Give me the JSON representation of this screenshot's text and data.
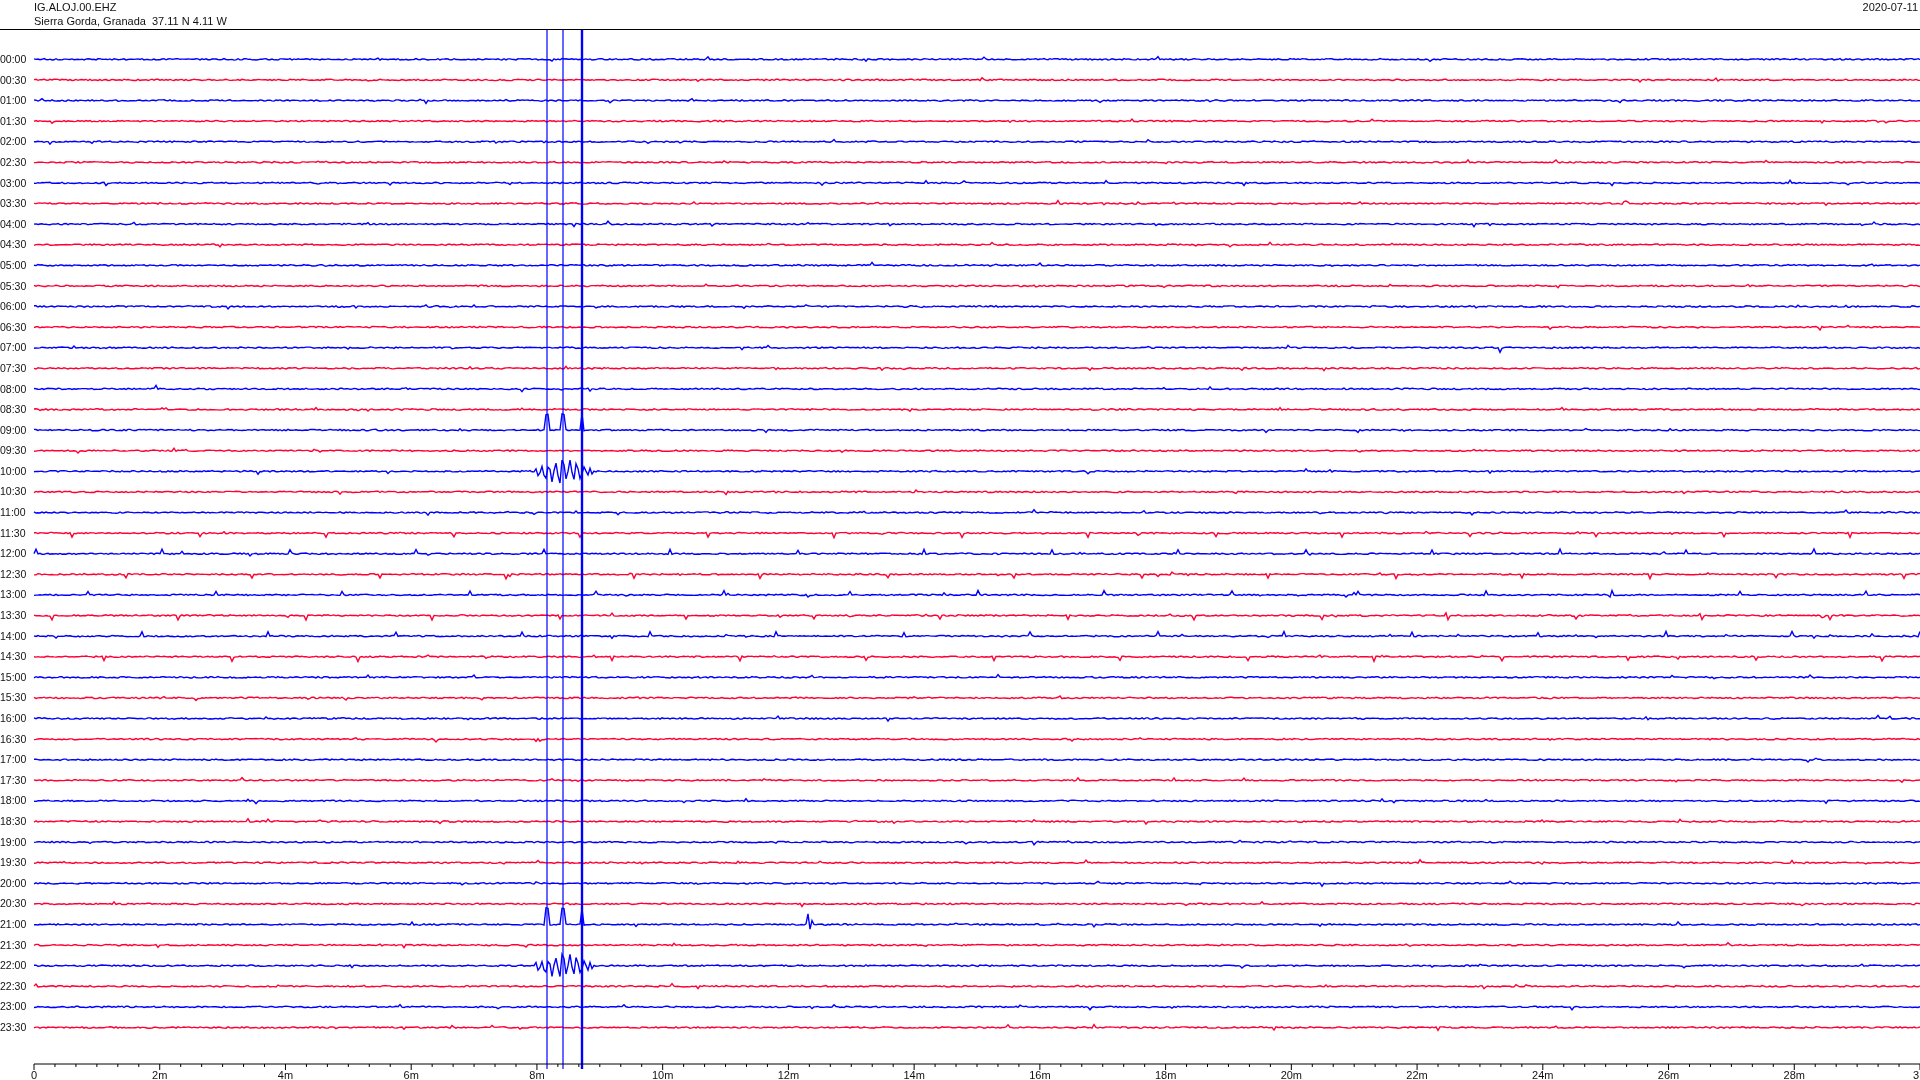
{
  "header": {
    "station": "IG.ALOJ.00.EHZ",
    "location": "Sierra Gorda, Granada  37.11 N 4.11 W",
    "date": "2020-07-11"
  },
  "rows": [
    {
      "label": "00:00",
      "color": "#0000ff"
    },
    {
      "label": "00:30",
      "color": "#ff0033"
    },
    {
      "label": "01:00",
      "color": "#0000ff"
    },
    {
      "label": "01:30",
      "color": "#ff0033"
    },
    {
      "label": "02:00",
      "color": "#0000ff"
    },
    {
      "label": "02:30",
      "color": "#ff0033"
    },
    {
      "label": "03:00",
      "color": "#0000ff"
    },
    {
      "label": "03:30",
      "color": "#ff0033"
    },
    {
      "label": "04:00",
      "color": "#0000ff"
    },
    {
      "label": "04:30",
      "color": "#ff0033"
    },
    {
      "label": "05:00",
      "color": "#0000ff"
    },
    {
      "label": "05:30",
      "color": "#ff0033"
    },
    {
      "label": "06:00",
      "color": "#0000ff"
    },
    {
      "label": "06:30",
      "color": "#ff0033"
    },
    {
      "label": "07:00",
      "color": "#0000ff"
    },
    {
      "label": "07:30",
      "color": "#ff0033"
    },
    {
      "label": "08:00",
      "color": "#0000ff"
    },
    {
      "label": "08:30",
      "color": "#ff0033"
    },
    {
      "label": "09:00",
      "color": "#0000ff"
    },
    {
      "label": "09:30",
      "color": "#ff0033"
    },
    {
      "label": "10:00",
      "color": "#0000ff"
    },
    {
      "label": "10:30",
      "color": "#ff0033"
    },
    {
      "label": "11:00",
      "color": "#0000ff"
    },
    {
      "label": "11:30",
      "color": "#ff0033"
    },
    {
      "label": "12:00",
      "color": "#0000ff"
    },
    {
      "label": "12:30",
      "color": "#ff0033"
    },
    {
      "label": "13:00",
      "color": "#0000ff"
    },
    {
      "label": "13:30",
      "color": "#ff0033"
    },
    {
      "label": "14:00",
      "color": "#0000ff"
    },
    {
      "label": "14:30",
      "color": "#ff0033"
    },
    {
      "label": "15:00",
      "color": "#0000ff"
    },
    {
      "label": "15:30",
      "color": "#ff0033"
    },
    {
      "label": "16:00",
      "color": "#0000ff"
    },
    {
      "label": "16:30",
      "color": "#ff0033"
    },
    {
      "label": "17:00",
      "color": "#0000ff"
    },
    {
      "label": "17:30",
      "color": "#ff0033"
    },
    {
      "label": "18:00",
      "color": "#0000ff"
    },
    {
      "label": "18:30",
      "color": "#ff0033"
    },
    {
      "label": "19:00",
      "color": "#0000ff"
    },
    {
      "label": "19:30",
      "color": "#ff0033"
    },
    {
      "label": "20:00",
      "color": "#0000ff"
    },
    {
      "label": "20:30",
      "color": "#ff0033"
    },
    {
      "label": "21:00",
      "color": "#0000ff"
    },
    {
      "label": "21:30",
      "color": "#ff0033"
    },
    {
      "label": "22:00",
      "color": "#0000ff"
    },
    {
      "label": "22:30",
      "color": "#ff0033"
    },
    {
      "label": "23:00",
      "color": "#0000ff"
    },
    {
      "label": "23:30",
      "color": "#ff0033"
    }
  ],
  "axis": {
    "ticks": [
      "0",
      "2m",
      "4m",
      "6m",
      "8m",
      "10m",
      "12m",
      "14m",
      "16m",
      "18m",
      "20m",
      "22m",
      "24m",
      "26m",
      "28m",
      "3"
    ]
  }
}
